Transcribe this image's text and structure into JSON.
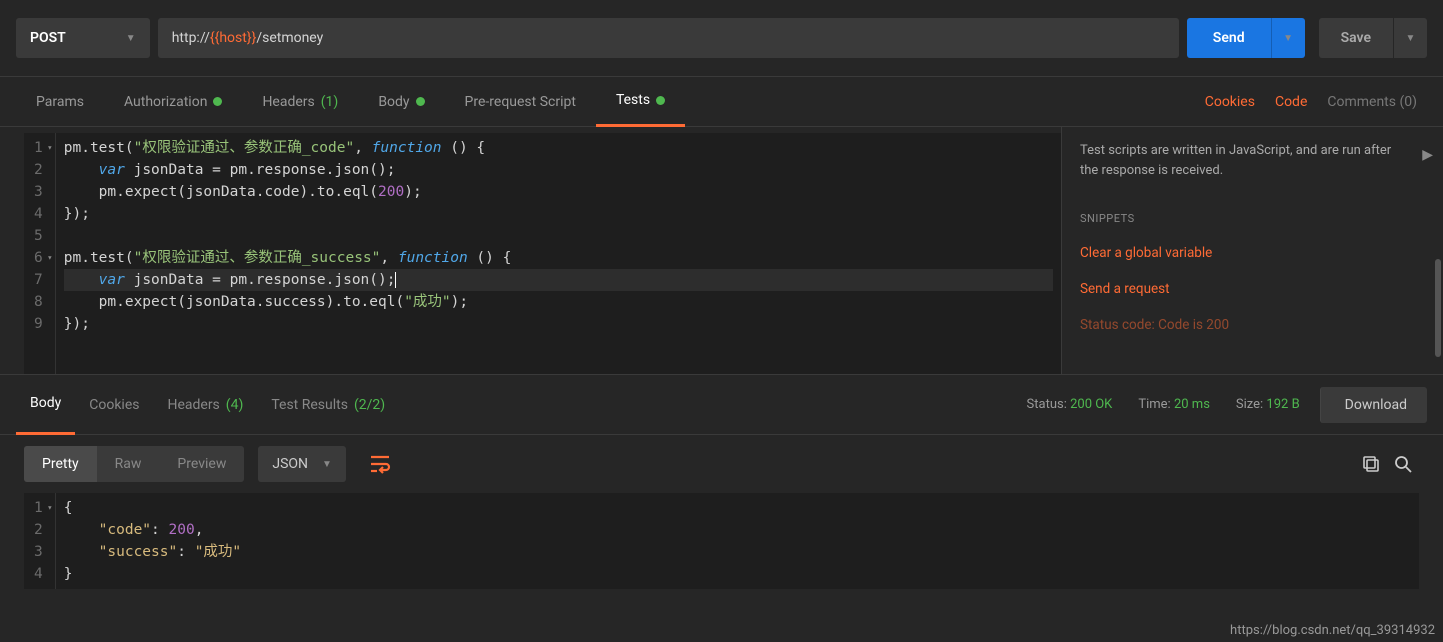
{
  "request": {
    "method": "POST",
    "url_prefix": "http://",
    "url_var": "{{host}}",
    "url_suffix": "/setmoney",
    "send_label": "Send",
    "save_label": "Save"
  },
  "req_tabs": {
    "params": "Params",
    "auth": "Authorization",
    "headers": "Headers",
    "headers_count": "(1)",
    "body": "Body",
    "prerequest": "Pre-request Script",
    "tests": "Tests"
  },
  "links": {
    "cookies": "Cookies",
    "code": "Code",
    "comments": "Comments (0)"
  },
  "tests_code": {
    "lines": [
      "1",
      "2",
      "3",
      "4",
      "5",
      "6",
      "7",
      "8",
      "9"
    ],
    "l1_str": "\"权限验证通过、参数正确_code\"",
    "l1_kw": "function",
    "l2_kw": "var",
    "l2_rest": " jsonData = pm.response.json();",
    "l3_num": "200",
    "l6_str": "\"权限验证通过、参数正确_success\"",
    "l6_kw": "function",
    "l7_kw": "var",
    "l7_rest": " jsonData = pm.response.json();",
    "l8_str": "\"成功\""
  },
  "snippets": {
    "desc": "Test scripts are written in JavaScript, and are run after the response is received.",
    "head": "SNIPPETS",
    "links": [
      "Clear a global variable",
      "Send a request",
      "Status code: Code is 200"
    ]
  },
  "response": {
    "tabs": {
      "body": "Body",
      "cookies": "Cookies",
      "headers": "Headers",
      "headers_count": "(4)",
      "testresults": "Test Results",
      "testresults_count": "(2/2)"
    },
    "status_lbl": "Status:",
    "status_val": "200 OK",
    "time_lbl": "Time:",
    "time_val": "20 ms",
    "size_lbl": "Size:",
    "size_val": "192 B",
    "download": "Download"
  },
  "view": {
    "pretty": "Pretty",
    "raw": "Raw",
    "preview": "Preview",
    "format": "JSON"
  },
  "json_body": {
    "lines": [
      "1",
      "2",
      "3",
      "4"
    ],
    "code_key": "\"code\"",
    "code_val": "200",
    "success_key": "\"success\"",
    "success_val": "\"成功\""
  },
  "watermark": "https://blog.csdn.net/qq_39314932"
}
